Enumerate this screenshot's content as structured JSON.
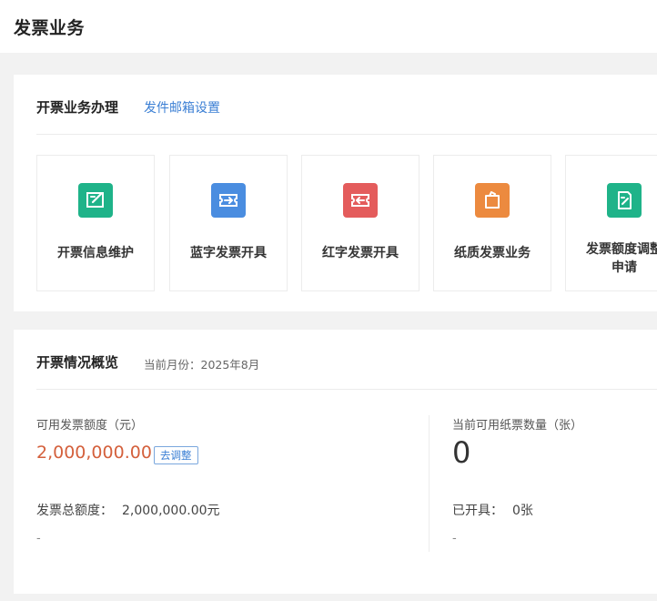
{
  "header": {
    "title": "发票业务"
  },
  "biz_panel": {
    "title": "开票业务办理",
    "link": "发件邮箱设置",
    "tiles": [
      {
        "label": "开票信息维护",
        "icon": "edit-square-icon",
        "color": "#1fb389"
      },
      {
        "label": "蓝字发票开具",
        "icon": "ticket-arrow-icon",
        "color": "#4a8de0"
      },
      {
        "label": "红字发票开具",
        "icon": "ticket-return-icon",
        "color": "#e45c5c"
      },
      {
        "label": "纸质发票业务",
        "icon": "paper-bag-icon",
        "color": "#ec8a3f"
      },
      {
        "label_line1": "发票额度调整",
        "label_line2": "申请",
        "icon": "document-pen-icon",
        "color": "#1fb389"
      }
    ]
  },
  "overview": {
    "title": "开票情况概览",
    "month_label": "当前月份：2025年8月",
    "available_label": "可用发票额度（元）",
    "available_value": "2,000,000.00",
    "adjust_button": "去调整",
    "total_label": "发票总额度：",
    "total_value": "2,000,000.00元",
    "left_dash": "-",
    "paper_label": "当前可用纸票数量（张）",
    "paper_value": "0",
    "issued_label": "已开具：",
    "issued_value": "0张",
    "right_dash": "-"
  }
}
